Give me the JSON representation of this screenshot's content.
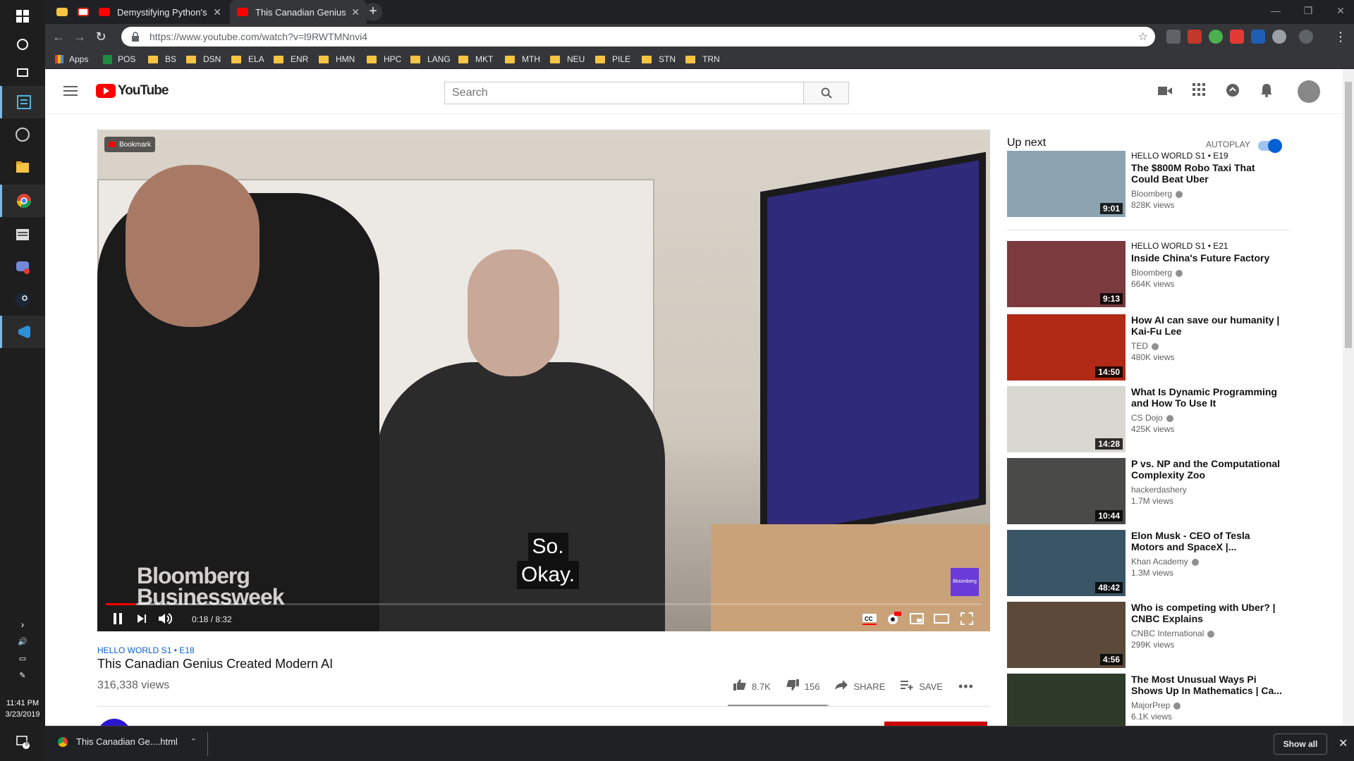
{
  "browser": {
    "tabs": [
      {
        "title": "Demystifying Python's Async and",
        "favicon_color": "#ff0000"
      },
      {
        "title": "This Canadian Genius Created",
        "favicon_color": "#ff0000"
      }
    ],
    "url": "https://www.youtube.com/watch?v=l9RWTMNnvi4",
    "bookmarks": [
      "Apps",
      "POS",
      "BS",
      "DSN",
      "ELA",
      "ENR",
      "HMN",
      "HPC",
      "LANG",
      "MKT",
      "MTH",
      "NEU",
      "PILE",
      "STN",
      "TRN"
    ]
  },
  "youtube": {
    "logo_text": "YouTube",
    "search_placeholder": "Search",
    "player": {
      "bookmark_chip": "Bookmark",
      "caption_lines": [
        "So.",
        "Okay."
      ],
      "watermark_lines": [
        "Bloomberg",
        "Businessweek"
      ],
      "badge": "Bloomberg",
      "time": "0:18 / 8:32",
      "progress_played_fraction": 0.035,
      "progress_loaded_fraction": 0.16
    },
    "video": {
      "tag": "HELLO WORLD  S1 • E18",
      "title": "This Canadian Genius Created Modern AI",
      "views": "316,338 views",
      "likes": "8.7K",
      "dislikes": "156",
      "share_label": "SHARE",
      "save_label": "SAVE",
      "like_fraction": 0.98
    },
    "up_next": {
      "label": "Up next",
      "autoplay_label": "AUTOPLAY",
      "items": [
        {
          "tag": "HELLO WORLD  S1 • E19",
          "title": "The $800M Robo Taxi That Could Beat Uber",
          "channel": "Bloomberg",
          "views": "828K views",
          "duration": "9:01",
          "thumb_color": "#8ea3b0"
        },
        {
          "tag": "HELLO WORLD  S1 • E21",
          "title": "Inside China's Future Factory",
          "channel": "Bloomberg",
          "views": "664K views",
          "duration": "9:13",
          "thumb_color": "#7a3a3e"
        },
        {
          "tag": "",
          "title": "How AI can save our humanity | Kai-Fu Lee",
          "channel": "TED",
          "views": "480K views",
          "duration": "14:50",
          "thumb_color": "#b02a16"
        },
        {
          "tag": "",
          "title": "What Is Dynamic Programming and How To Use It",
          "channel": "CS Dojo",
          "views": "425K views",
          "duration": "14:28",
          "thumb_color": "#d9d7d2"
        },
        {
          "tag": "",
          "title": "P vs. NP and the Computational Complexity Zoo",
          "channel": "hackerdashery",
          "views": "1.7M views",
          "duration": "10:44",
          "thumb_color": "#4a4a48"
        },
        {
          "tag": "",
          "title": "Elon Musk - CEO of Tesla Motors and SpaceX |...",
          "channel": "Khan Academy",
          "views": "1.3M views",
          "duration": "48:42",
          "thumb_color": "#3a5566"
        },
        {
          "tag": "",
          "title": "Who is competing with Uber? | CNBC Explains",
          "channel": "CNBC International",
          "views": "299K views",
          "duration": "4:56",
          "thumb_color": "#5b4a3a"
        },
        {
          "tag": "",
          "title": "The Most Unusual Ways Pi Shows Up In Mathematics | Ca...",
          "channel": "MajorPrep",
          "views": "6.1K views",
          "duration": "",
          "thumb_color": "#2e3a2a"
        }
      ]
    }
  },
  "taskbar": {
    "time": "11:41 PM",
    "date": "3/23/2019",
    "notification_count": "5"
  },
  "download_bar": {
    "filename": "This Canadian Ge....html",
    "show_all_label": "Show all"
  },
  "colors": {
    "accent_red": "#ff0000",
    "link_blue": "#065fd4"
  }
}
